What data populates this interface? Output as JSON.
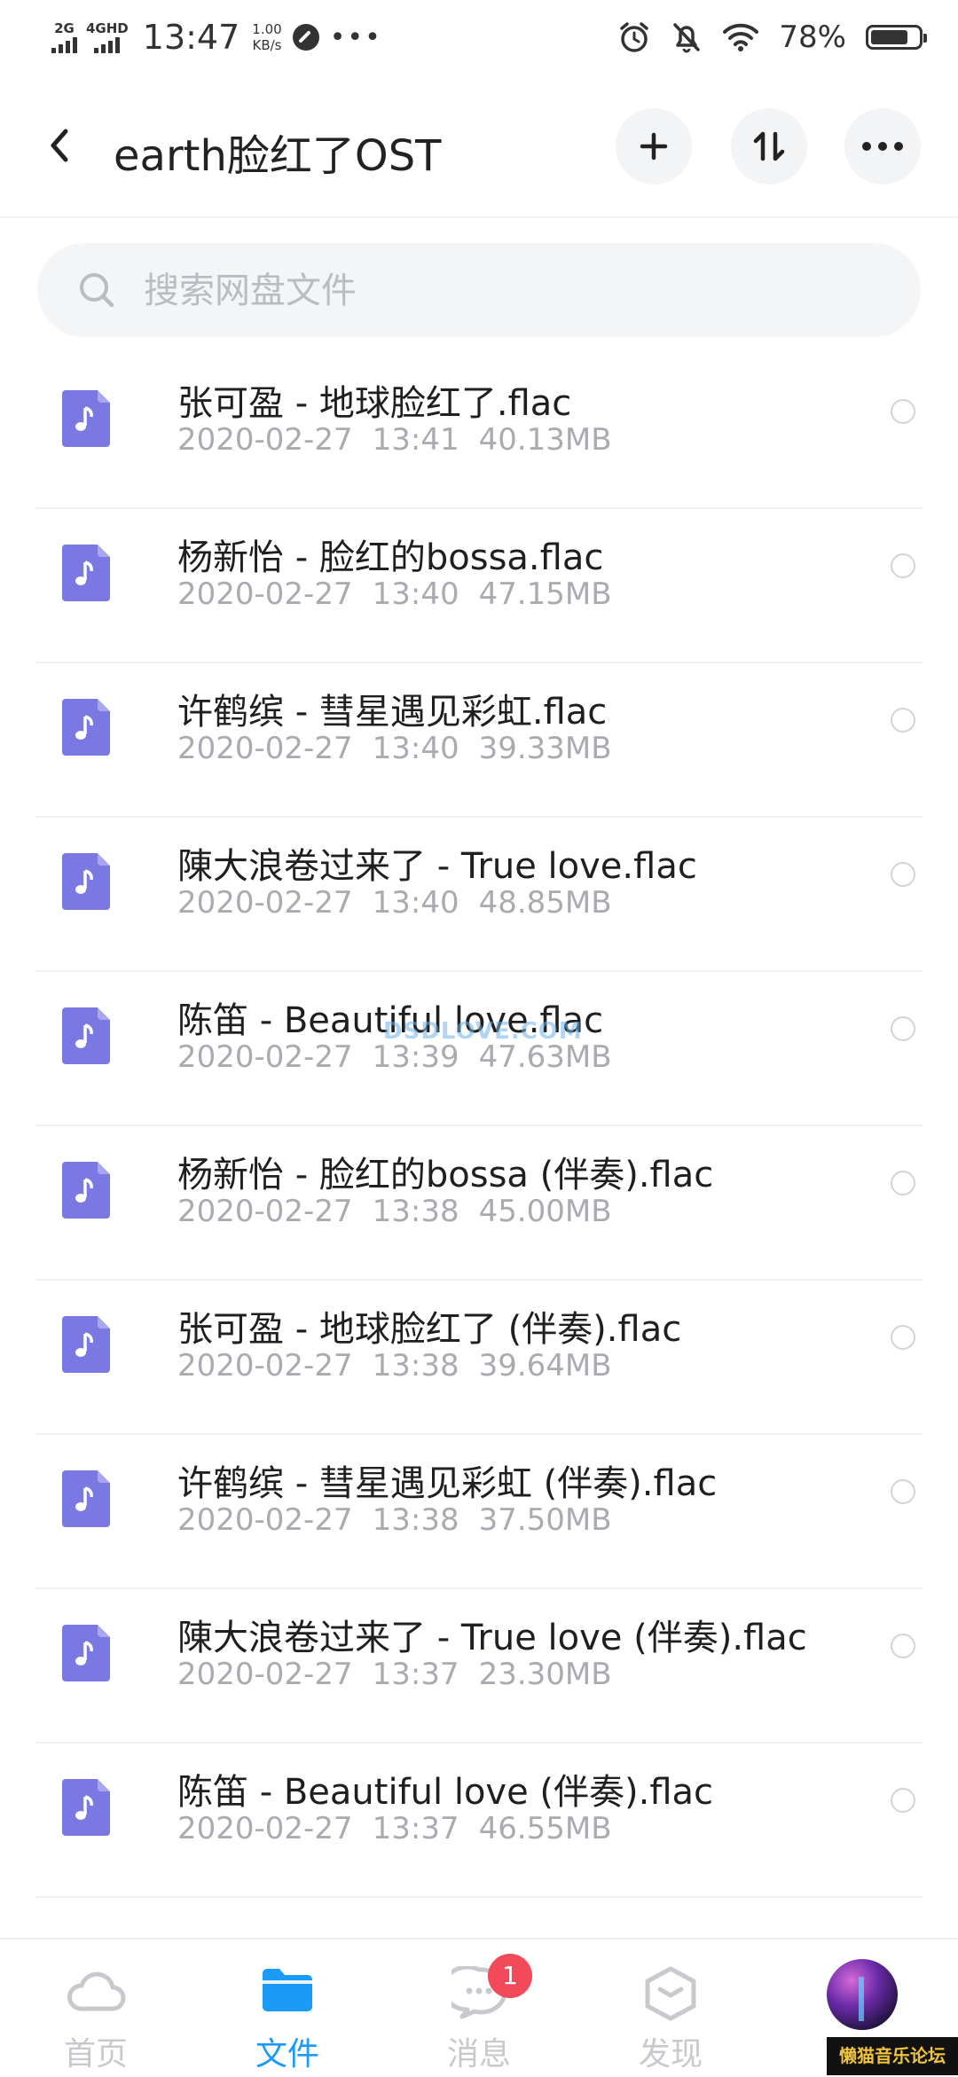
{
  "status_bar": {
    "net1": "2G",
    "net2": "4GHD",
    "time": "13:47",
    "speed_value": "1.00",
    "speed_unit": "KB/s",
    "more": "•••",
    "battery_percent": "78%",
    "battery_level": 0.78
  },
  "header": {
    "title": "earth脸红了OST"
  },
  "search": {
    "placeholder": "搜索网盘文件"
  },
  "files": [
    {
      "name": "张可盈 - 地球脸红了.flac",
      "date": "2020-02-27",
      "time": "13:41",
      "size": "40.13MB"
    },
    {
      "name": "杨新怡 - 脸红的bossa.flac",
      "date": "2020-02-27",
      "time": "13:40",
      "size": "47.15MB"
    },
    {
      "name": "许鹤缤 - 彗星遇见彩虹.flac",
      "date": "2020-02-27",
      "time": "13:40",
      "size": "39.33MB"
    },
    {
      "name": "陳大浪卷过来了 - True love.flac",
      "date": "2020-02-27",
      "time": "13:40",
      "size": "48.85MB"
    },
    {
      "name": "陈笛 - Beautiful love.flac",
      "date": "2020-02-27",
      "time": "13:39",
      "size": "47.63MB"
    },
    {
      "name": "杨新怡 - 脸红的bossa (伴奏).flac",
      "date": "2020-02-27",
      "time": "13:38",
      "size": "45.00MB"
    },
    {
      "name": "张可盈 - 地球脸红了 (伴奏).flac",
      "date": "2020-02-27",
      "time": "13:38",
      "size": "39.64MB"
    },
    {
      "name": "许鹤缤 - 彗星遇见彩虹 (伴奏).flac",
      "date": "2020-02-27",
      "time": "13:38",
      "size": "37.50MB"
    },
    {
      "name": "陳大浪卷过来了 - True love (伴奏).flac",
      "date": "2020-02-27",
      "time": "13:37",
      "size": "23.30MB"
    },
    {
      "name": "陈笛 - Beautiful love (伴奏).flac",
      "date": "2020-02-27",
      "time": "13:37",
      "size": "46.55MB"
    }
  ],
  "watermark": "DSDLOVE.COM",
  "bottom_nav": {
    "home": "首页",
    "files": "文件",
    "messages": "消息",
    "messages_badge": "1",
    "discover": "发现"
  },
  "forum_logo": "懒猫音乐论坛",
  "colors": {
    "accent": "#1b9af7",
    "file_icon": "#7a78e3",
    "badge": "#f24a5a"
  }
}
